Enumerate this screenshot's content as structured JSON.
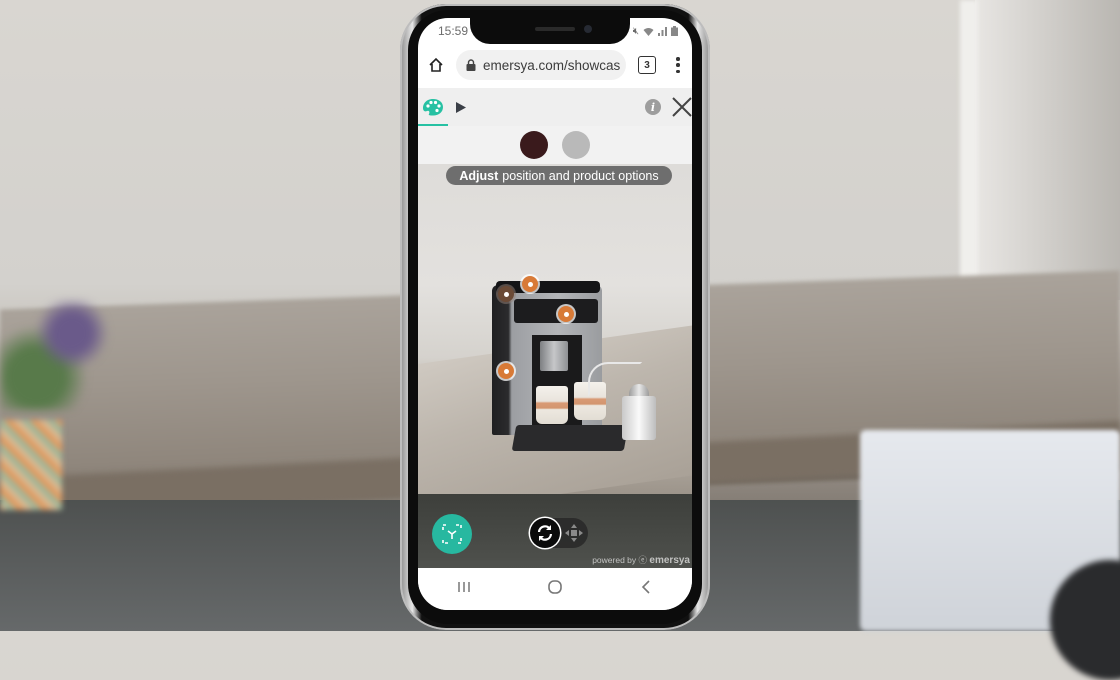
{
  "status_bar": {
    "time": "15:59",
    "icons": [
      "notification-icon",
      "mute-icon",
      "wifi-icon",
      "signal-icon",
      "battery-icon"
    ]
  },
  "browser": {
    "url": "emersya.com/showcas",
    "tab_count": "3",
    "icons": {
      "home": "home-icon",
      "lock": "lock-icon",
      "menu": "more-vert-icon"
    }
  },
  "app_toolbar": {
    "tabs": [
      {
        "name": "configure",
        "icon": "palette-icon",
        "active": true
      },
      {
        "name": "play",
        "icon": "play-icon",
        "active": false
      }
    ],
    "info_label": "i",
    "close_icon": "close-icon"
  },
  "swatches": [
    {
      "name": "dark-brown",
      "color": "#3a1a1c",
      "selected": true
    },
    {
      "name": "silver",
      "color": "#b9b9b9",
      "selected": false
    }
  ],
  "hint": {
    "bold": "Adjust",
    "rest": "position and product options"
  },
  "ar_scene": {
    "hotspots": 4,
    "hotspot_color": "#d87a37"
  },
  "controls": {
    "ar_button_icon": "ar-view-icon",
    "rotate_icon": "rotate-icon",
    "move_icon": "move-icon",
    "accent_color": "#27b8a0"
  },
  "branding": {
    "powered_by": "powered by",
    "brand": "emersya"
  },
  "android_nav": {
    "buttons": [
      "recents-icon",
      "home-circle-icon",
      "back-icon"
    ]
  }
}
